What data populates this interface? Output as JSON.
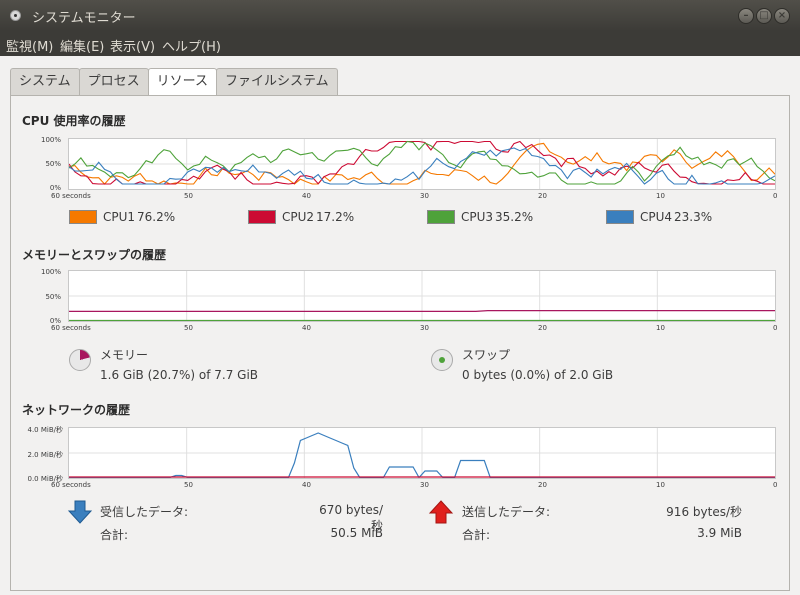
{
  "window": {
    "title": "システムモニター"
  },
  "menu": [
    "監視(M)",
    "編集(E)",
    "表示(V)",
    "ヘルプ(H)"
  ],
  "tabs": [
    "システム",
    "プロセス",
    "リソース",
    "ファイルシステム"
  ],
  "active_tab": "リソース",
  "cpu": {
    "title": "CPU 使用率の履歴",
    "y_labels": [
      "100%",
      "50%",
      "0%"
    ],
    "x_labels": [
      "60 seconds",
      "50",
      "40",
      "30",
      "20",
      "10",
      "0"
    ],
    "legend": [
      {
        "label": "CPU1",
        "value": "76.2%",
        "color": "#f57900"
      },
      {
        "label": "CPU2",
        "value": "17.2%",
        "color": "#cc0a33"
      },
      {
        "label": "CPU3",
        "value": "35.2%",
        "color": "#4ea23a"
      },
      {
        "label": "CPU4",
        "value": "23.3%",
        "color": "#3a7fbe"
      }
    ]
  },
  "memory": {
    "title": "メモリーとスワップの履歴",
    "y_labels": [
      "100%",
      "50%",
      "0%"
    ],
    "x_labels": [
      "60 seconds",
      "50",
      "40",
      "30",
      "20",
      "10",
      "0"
    ],
    "memory_label": "メモリー",
    "memory_value": "1.6 GiB (20.7%) of 7.7 GiB",
    "memory_fraction": 0.207,
    "memory_color": "#a8175e",
    "swap_label": "スワップ",
    "swap_value": "0 bytes (0.0%) of 2.0 GiB",
    "swap_fraction": 0.0,
    "swap_color": "#4ea23a"
  },
  "network": {
    "title": "ネットワークの履歴",
    "y_labels": [
      "4.0 MiB/秒",
      "2.0 MiB/秒",
      "0.0 MiB/秒"
    ],
    "x_labels": [
      "60 seconds",
      "50",
      "40",
      "30",
      "20",
      "10",
      "0"
    ],
    "receive_label": "受信したデータ:",
    "receive_rate": "670 bytes/秒",
    "receive_total_label": "合計:",
    "receive_total": "50.5 MiB",
    "receive_color": "#3a7fbe",
    "send_label": "送信したデータ:",
    "send_rate": "916 bytes/秒",
    "send_total_label": "合計:",
    "send_total": "3.9 MiB",
    "send_color": "#cc0a33"
  }
}
